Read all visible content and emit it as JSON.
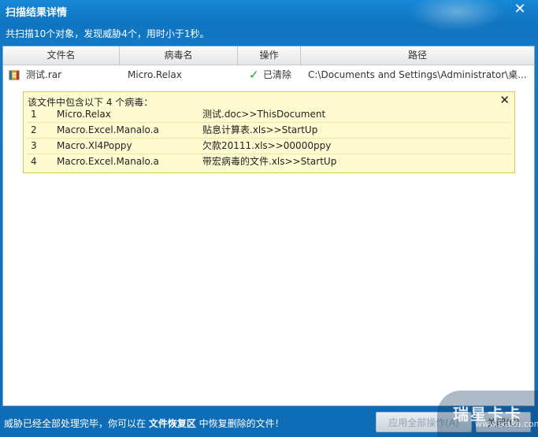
{
  "window": {
    "title": "扫描结果详情",
    "close_glyph": "✕",
    "summary": "共扫描10个对象，发现威胁4个，用时小于1秒。"
  },
  "table": {
    "headers": [
      "文件名",
      "病毒名",
      "操作",
      "路径"
    ],
    "rows": [
      {
        "file_name": "测试.rar",
        "virus_name": "Micro.Relax",
        "action_icon": "✓",
        "action": "已清除",
        "path": "C:\\Documents and Settings\\Administrator\\桌..."
      }
    ]
  },
  "popup": {
    "title": "该文件中包含以下  4 个病毒：",
    "close_glyph": "✕",
    "items": [
      {
        "index": "1",
        "virus": "Micro.Relax",
        "location": "测试.doc>>ThisDocument"
      },
      {
        "index": "2",
        "virus": "Macro.Excel.Manalo.a",
        "location": "贴息计算表.xls>>StartUp"
      },
      {
        "index": "3",
        "virus": "Macro.Xl4Poppy",
        "location": "欠款20111.xls>>00000ppy"
      },
      {
        "index": "4",
        "virus": "Macro.Excel.Manalo.a",
        "location": "带宏病毒的文件.xls>>StartUp"
      }
    ]
  },
  "footer": {
    "text_before": "威胁已经全部处理完毕，你可以在 ",
    "link": "文件恢复区",
    "text_after": " 中恢复删除的文件！",
    "apply_all_button": "应用全部操作(A)",
    "close_button": "关闭(C)"
  },
  "watermark": {
    "brand": "瑞星卡卡",
    "url": "www.ikaka.com"
  },
  "colors": {
    "accent": "#1479c5",
    "popup_bg": "#fffbd0",
    "check": "#22a022"
  }
}
